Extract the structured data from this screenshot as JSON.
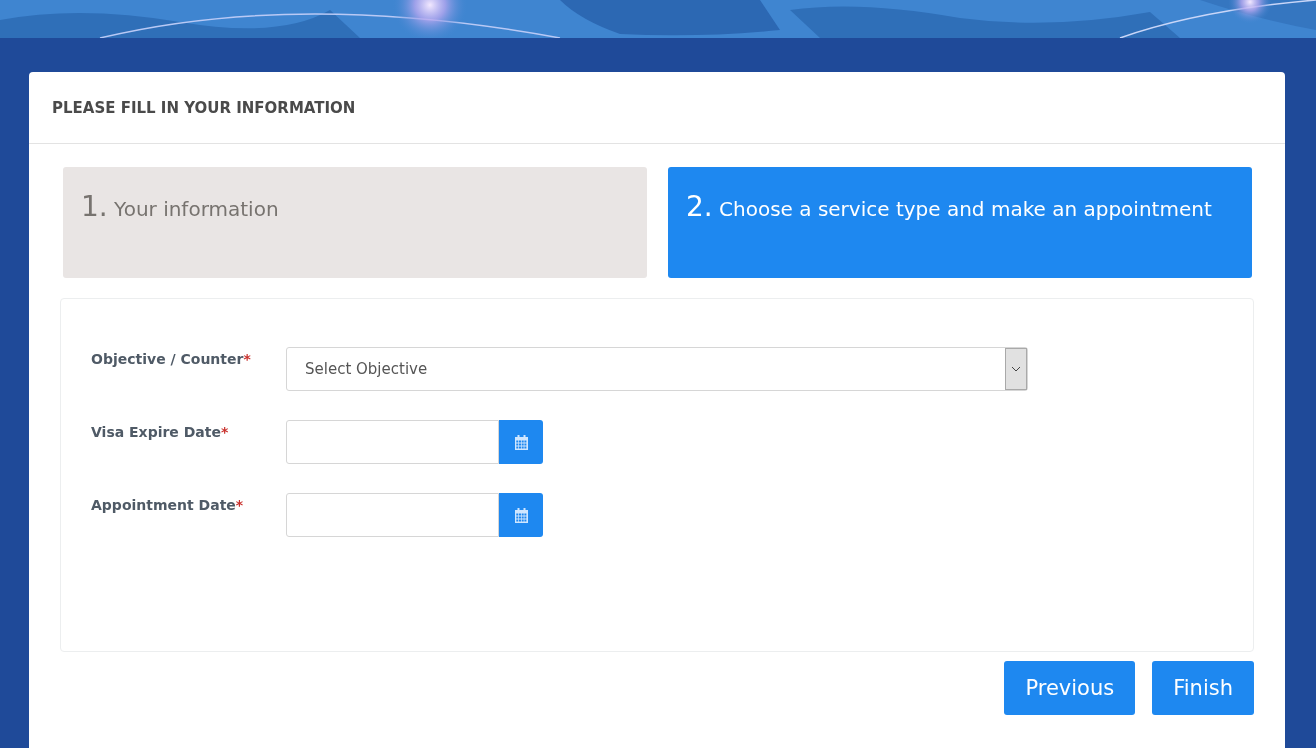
{
  "banner": {
    "kind": "picture"
  },
  "card": {
    "title": "PLEASE FILL IN YOUR INFORMATION"
  },
  "steps": [
    {
      "number": "1.",
      "title": "Your information",
      "selected": false
    },
    {
      "number": "2.",
      "title": "Choose a service type and make an appointment",
      "selected": true
    }
  ],
  "fields": [
    {
      "kind": "select",
      "label": "Objective / Counter",
      "required": "*",
      "placeholder": "Select Objective"
    },
    {
      "kind": "date",
      "label": "Visa Expire Date",
      "required": "*"
    },
    {
      "kind": "date",
      "label": "Appointment Date",
      "required": "*"
    }
  ],
  "buttons": [
    "Previous",
    "Finish"
  ]
}
